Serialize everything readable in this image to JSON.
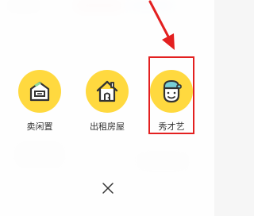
{
  "actions": [
    {
      "label": "卖闲置",
      "icon": "box-house-icon"
    },
    {
      "label": "出租房屋",
      "icon": "house-icon"
    },
    {
      "label": "秀才艺",
      "icon": "face-icon"
    }
  ],
  "close": {
    "icon": "close-icon"
  },
  "annotation": {
    "highlight_color": "#e32020",
    "arrow_color": "#e32020"
  },
  "colors": {
    "icon_bg": "#ffd93f",
    "icon_stroke": "#333333",
    "accent_green": "#8fd99a",
    "accent_teal": "#79cfd6"
  }
}
